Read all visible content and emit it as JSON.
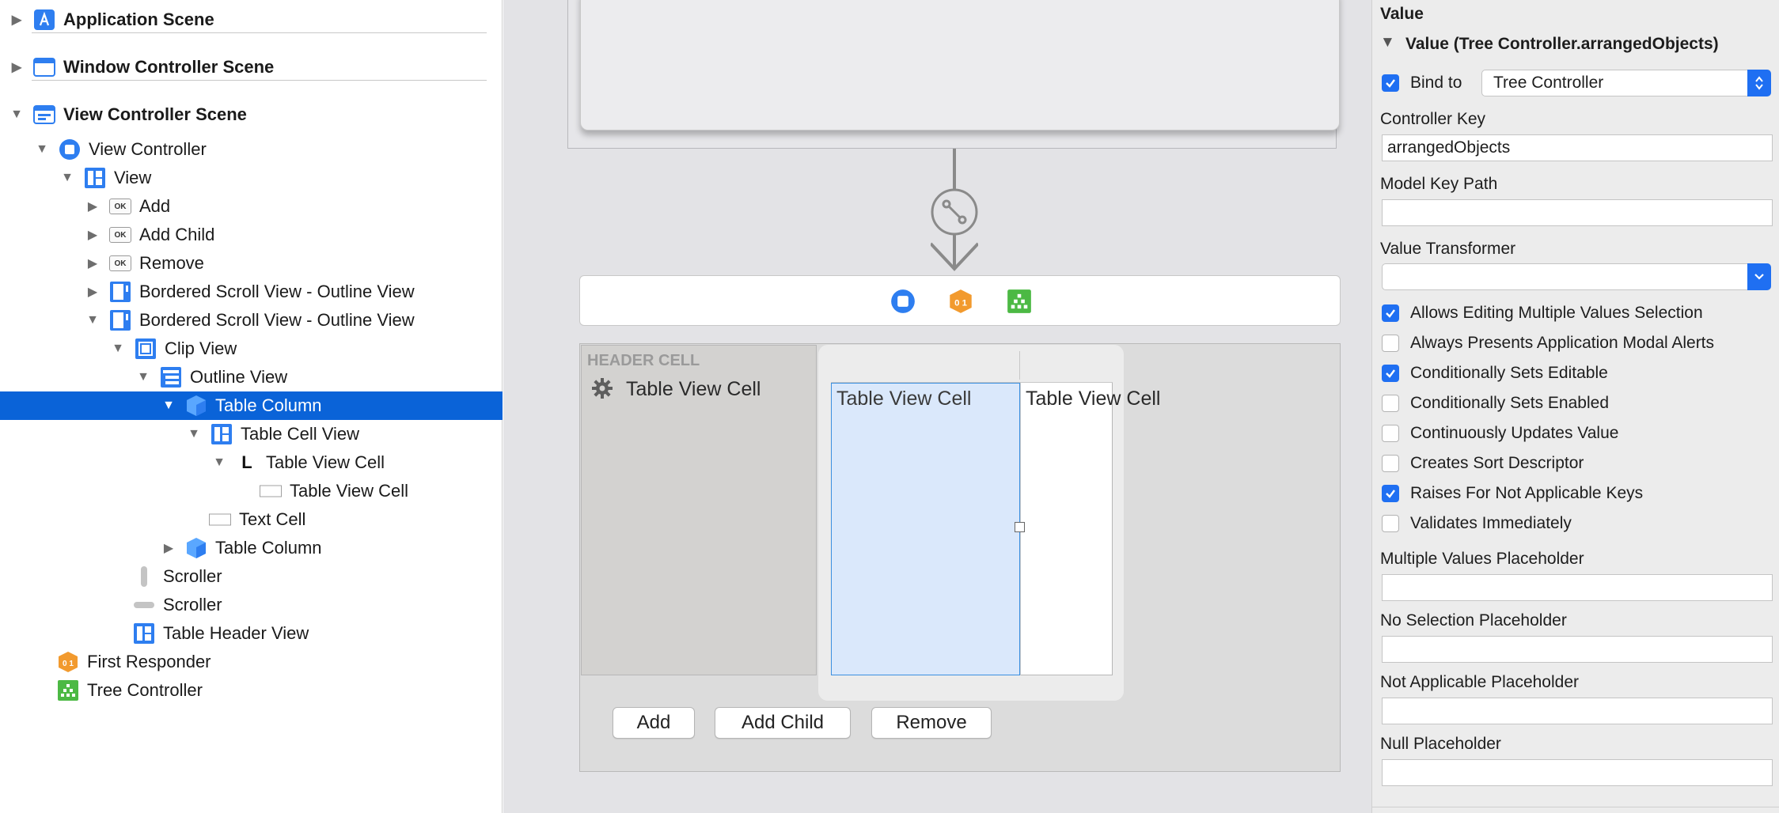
{
  "navigator": {
    "scenes": [
      {
        "label": "Application Scene"
      },
      {
        "label": "Window Controller Scene"
      },
      {
        "label": "View Controller Scene"
      }
    ],
    "items": [
      {
        "label": "View Controller"
      },
      {
        "label": "View"
      },
      {
        "label": "Add",
        "icon_text": "OK"
      },
      {
        "label": "Add Child",
        "icon_text": "OK"
      },
      {
        "label": "Remove",
        "icon_text": "OK"
      },
      {
        "label": "Bordered Scroll View - Outline View"
      },
      {
        "label": "Bordered Scroll View - Outline View"
      },
      {
        "label": "Clip View"
      },
      {
        "label": "Outline View"
      },
      {
        "label": "Table Column"
      },
      {
        "label": "Table Cell View"
      },
      {
        "label": "Table View Cell",
        "icon_text": "L"
      },
      {
        "label": "Table View Cell"
      },
      {
        "label": "Text Cell"
      },
      {
        "label": "Table Column"
      },
      {
        "label": "Scroller"
      },
      {
        "label": "Scroller"
      },
      {
        "label": "Table Header View"
      },
      {
        "label": "First Responder"
      },
      {
        "label": "Tree Controller"
      }
    ]
  },
  "canvas": {
    "header_cell": "HEADER CELL",
    "prototype_cell": "Table View Cell",
    "column1_cell": "Table View Cell",
    "column2_cell": "Table View Cell",
    "buttons": {
      "add": "Add",
      "add_child": "Add Child",
      "remove": "Remove"
    }
  },
  "inspector": {
    "section_title": "Value",
    "binding_title": "Value (Tree Controller.arrangedObjects)",
    "bind_to_label": "Bind to",
    "bind_to_value": "Tree Controller",
    "controller_key_label": "Controller Key",
    "controller_key_value": "arrangedObjects",
    "model_key_path_label": "Model Key Path",
    "model_key_path_value": "",
    "value_transformer_label": "Value Transformer",
    "value_transformer_value": "",
    "options": [
      {
        "label": "Allows Editing Multiple Values Selection",
        "checked": true
      },
      {
        "label": "Always Presents Application Modal Alerts",
        "checked": false
      },
      {
        "label": "Conditionally Sets Editable",
        "checked": true
      },
      {
        "label": "Conditionally Sets Enabled",
        "checked": false
      },
      {
        "label": "Continuously Updates Value",
        "checked": false
      },
      {
        "label": "Creates Sort Descriptor",
        "checked": false
      },
      {
        "label": "Raises For Not Applicable Keys",
        "checked": true
      },
      {
        "label": "Validates Immediately",
        "checked": false
      }
    ],
    "multiple_values_label": "Multiple Values Placeholder",
    "no_selection_label": "No Selection Placeholder",
    "not_applicable_label": "Not Applicable Placeholder",
    "null_placeholder_label": "Null Placeholder",
    "colors": {
      "accent": "#1f6ff2",
      "selection": "#0a63d8"
    }
  }
}
